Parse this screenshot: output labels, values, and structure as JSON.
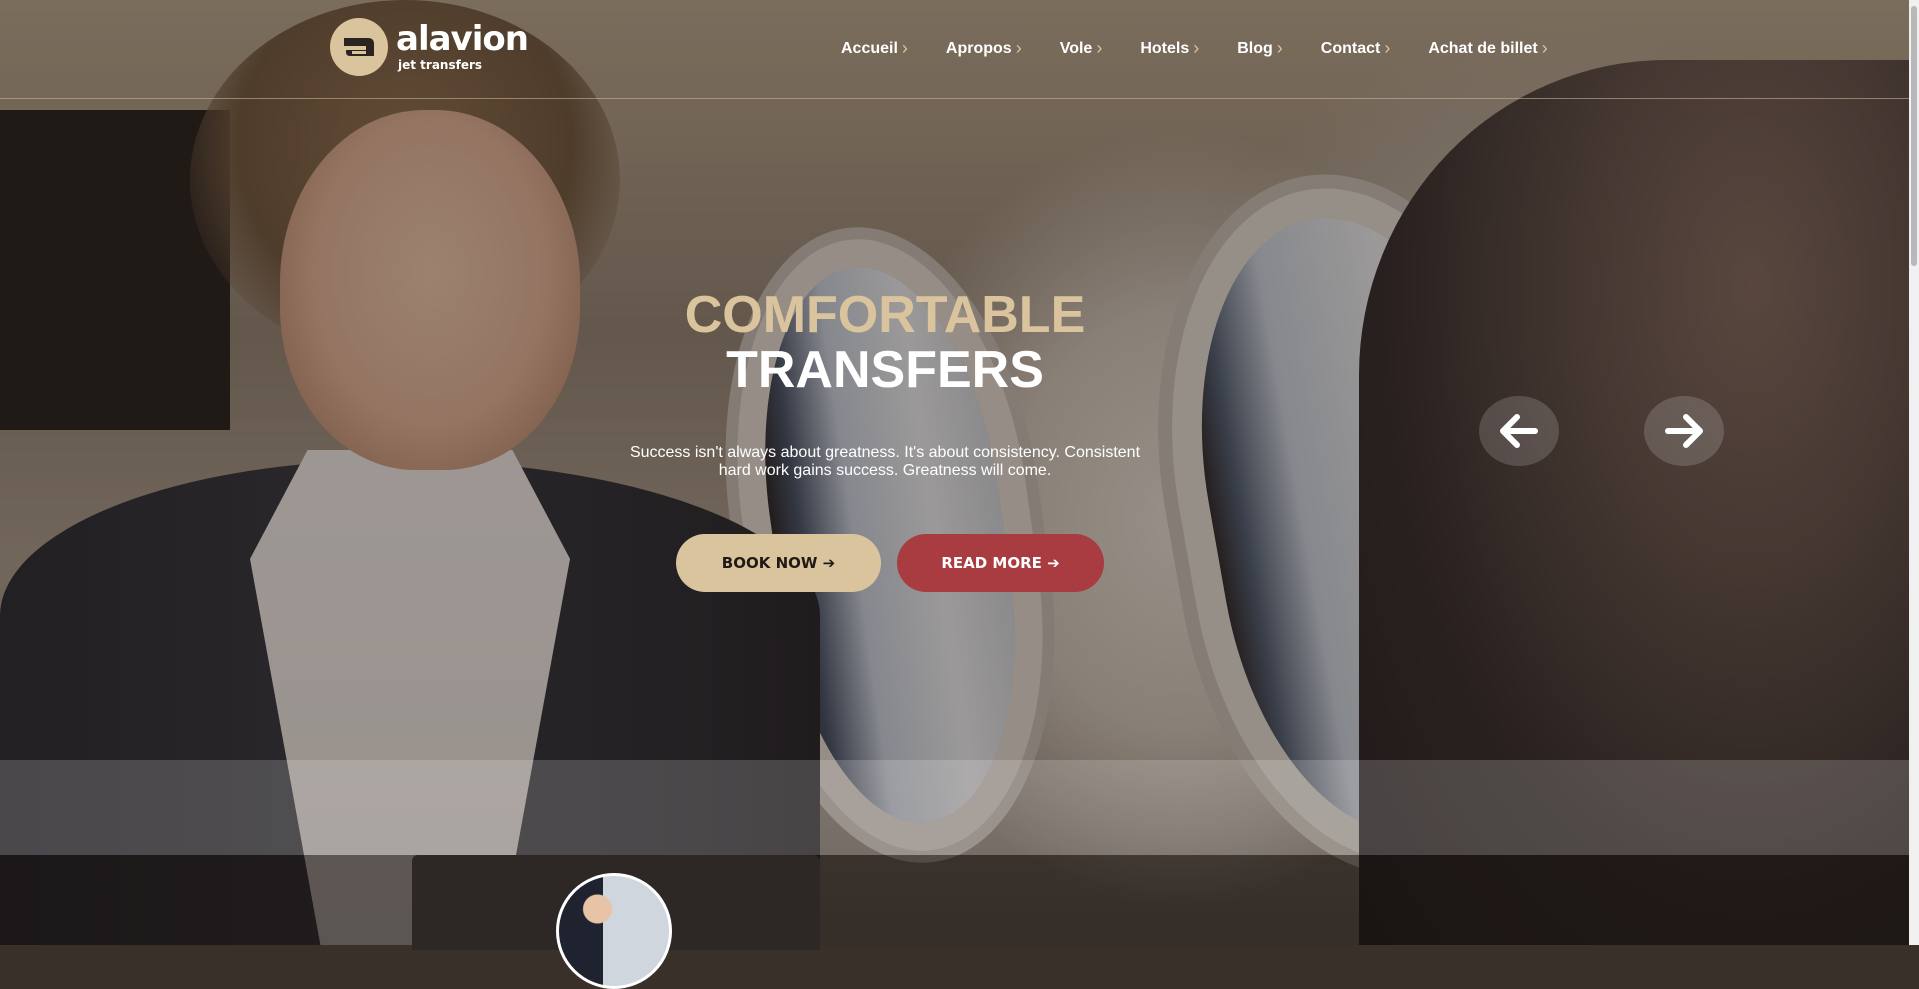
{
  "header": {
    "brand": "alavion",
    "tagline": "jet transfers",
    "nav": [
      {
        "label": "Accueil"
      },
      {
        "label": "Apropos"
      },
      {
        "label": "Vole"
      },
      {
        "label": "Hotels"
      },
      {
        "label": "Blog"
      },
      {
        "label": "Contact"
      },
      {
        "label": "Achat de billet"
      }
    ]
  },
  "hero": {
    "title_line1": "COMFORTABLE",
    "title_line2": "TRANSFERS",
    "subtitle": "Success isn't always about greatness. It's about consistency. Consistent hard work gains success. Greatness will come.",
    "book_button": "BOOK NOW ➔",
    "read_button": "READ MORE ➔"
  },
  "colors": {
    "accent_gold": "#d9c49d",
    "accent_red": "#a83c40"
  },
  "icons": {
    "prev": "arrow-left-icon",
    "next": "arrow-right-icon"
  }
}
